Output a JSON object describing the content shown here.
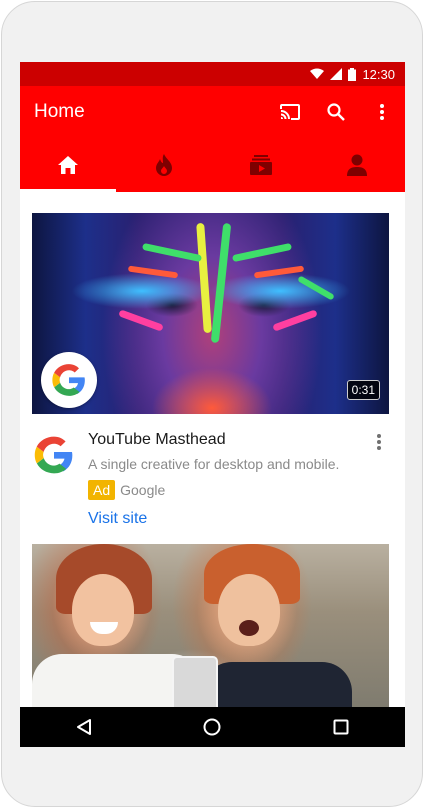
{
  "status_bar": {
    "time": "12:30",
    "icons": [
      "wifi-icon",
      "signal-icon",
      "battery-icon"
    ]
  },
  "app_bar": {
    "title": "Home",
    "actions": [
      "cast-icon",
      "search-icon",
      "more-vert-icon"
    ]
  },
  "tabs": [
    {
      "icon": "home-icon",
      "selected": true
    },
    {
      "icon": "trending-icon",
      "selected": false
    },
    {
      "icon": "subscriptions-icon",
      "selected": false
    },
    {
      "icon": "account-icon",
      "selected": false
    }
  ],
  "ad": {
    "duration": "0:31",
    "title": "YouTube Masthead",
    "description": "A single creative for desktop and mobile.",
    "badge": "Ad",
    "advertiser": "Google",
    "cta": "Visit site"
  },
  "nav_bar": {
    "buttons": [
      "back-icon",
      "home-circle-icon",
      "recents-icon"
    ]
  },
  "colors": {
    "app_bar": "#ff0000",
    "status_bar": "#cc0000",
    "ad_badge": "#f2b400",
    "link": "#1a73e8"
  }
}
